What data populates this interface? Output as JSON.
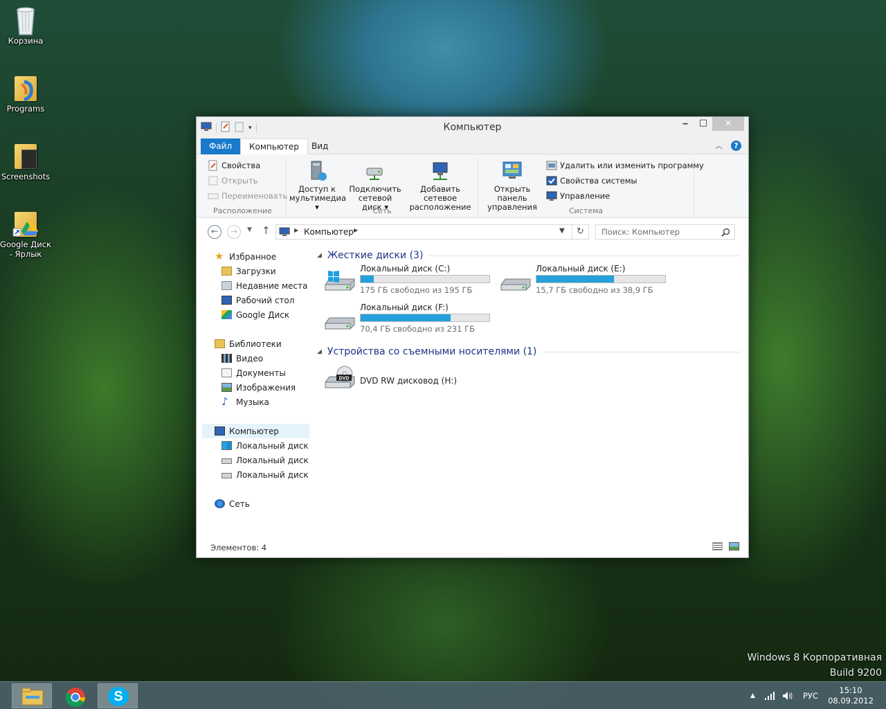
{
  "desktop": {
    "icons": [
      {
        "label": "Корзина"
      },
      {
        "label": "Programs"
      },
      {
        "label": "Screenshots"
      },
      {
        "label": "Google Диск - Ярлык"
      }
    ],
    "watermark": {
      "line1": "Windows 8 Корпоративная",
      "line2": "Build 9200"
    }
  },
  "window": {
    "title": "Компьютер",
    "controls": {
      "minimize": "‒",
      "maximize": "□",
      "close": "✕"
    },
    "tabs": {
      "file": "Файл",
      "computer": "Компьютер",
      "view": "Вид"
    },
    "ribbon": {
      "location": {
        "label": "Расположение",
        "properties": "Свойства",
        "open": "Открыть",
        "rename": "Переименовать"
      },
      "network": {
        "label": "Сеть",
        "media_access": {
          "line1": "Доступ к",
          "line2": "мультимедиа"
        },
        "map_drive": {
          "line1": "Подключить",
          "line2": "сетевой диск"
        },
        "add_location": {
          "line1": "Добавить сетевое",
          "line2": "расположение"
        }
      },
      "system": {
        "label": "Система",
        "control_panel": {
          "line1": "Открыть панель",
          "line2": "управления"
        },
        "uninstall": "Удалить или изменить программу",
        "system_properties": "Свойства системы",
        "manage": "Управление"
      }
    },
    "address": {
      "location": "Компьютер"
    },
    "search": {
      "placeholder": "Поиск: Компьютер"
    },
    "nav": {
      "favorites": "Избранное",
      "downloads": "Загрузки",
      "recent": "Недавние места",
      "desktop": "Рабочий стол",
      "gdrive": "Google Диск",
      "libraries": "Библиотеки",
      "video": "Видео",
      "documents": "Документы",
      "images": "Изображения",
      "music": "Музыка",
      "computer": "Компьютер",
      "disk_c": "Локальный диск (C",
      "disk_e": "Локальный диск (E:",
      "disk_f": "Локальный диск (F:",
      "network": "Сеть"
    },
    "content": {
      "hard_drives": {
        "title": "Жесткие диски",
        "count": "(3)"
      },
      "drives": [
        {
          "name": "Локальный диск (C:)",
          "free": "175 ГБ свободно из 195 ГБ",
          "used_fraction": 0.1
        },
        {
          "name": "Локальный диск (E:)",
          "free": "15,7 ГБ свободно из 38,9 ГБ",
          "used_fraction": 0.6
        },
        {
          "name": "Локальный диск (F:)",
          "free": "70,4 ГБ свободно из 231 ГБ",
          "used_fraction": 0.7
        }
      ],
      "removable": {
        "title": "Устройства со съемными носителями",
        "count": "(1)"
      },
      "dvd": {
        "name": "DVD RW дисковод (H:)",
        "badge": "DVD"
      }
    },
    "status": {
      "items": "Элементов: 4"
    }
  },
  "taskbar": {
    "lang": "РУС",
    "time": "15:10",
    "date": "08.09.2012"
  },
  "colors": {
    "accent": "#1979ca",
    "bar_fill": "#26a0da",
    "header_text": "#1e3287"
  }
}
